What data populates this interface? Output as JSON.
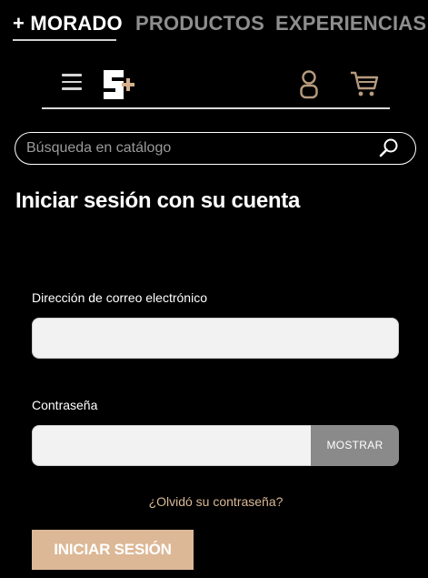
{
  "top_nav": {
    "tabs": [
      "+ MORADO",
      "PRODUCTOS",
      "EXPERIENCIAS"
    ],
    "active_tab": "+ MORADO"
  },
  "header": {
    "menu_icon": "hamburger-menu-icon",
    "logo_icon": "s-plus-logo",
    "account_icon": "user-icon",
    "cart_icon": "shopping-cart-icon"
  },
  "search": {
    "placeholder": "Búsqueda en catálogo",
    "value": "",
    "icon": "search-icon"
  },
  "page": {
    "title": "Iniciar sesión con su cuenta"
  },
  "form": {
    "email_label": "Dirección de correo electrónico",
    "email_value": "",
    "password_label": "Contraseña",
    "password_value": "",
    "show_label": "MOSTRAR",
    "forgot_label": "¿Olvidó su contraseña?",
    "submit_label": "INICIAR SESIÓN"
  },
  "colors": {
    "background": "#000000",
    "accent": "#dcb896",
    "inactive_tab": "#8e8e8e",
    "input_bg": "#f2f2f2",
    "show_button_bg": "#8a8a8a"
  }
}
